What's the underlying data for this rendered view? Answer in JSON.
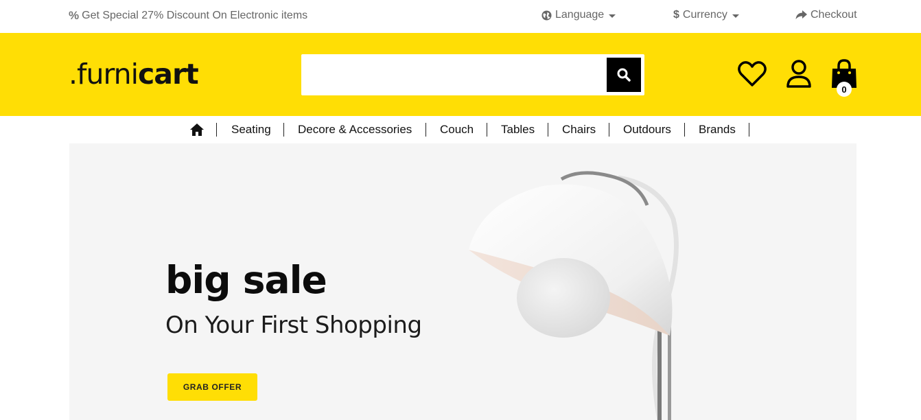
{
  "topbar": {
    "promo_icon": "percent-icon",
    "promo_text": "Get Special 27% Discount On Electronic items",
    "language_label": "Language",
    "currency_label": "Currency",
    "checkout_label": "Checkout"
  },
  "header": {
    "logo_prefix": ".furni",
    "logo_suffix": "cart",
    "search_placeholder": "",
    "cart_count": "0",
    "icons": [
      "heart-icon",
      "user-icon",
      "cart-bag-icon",
      "search-icon"
    ]
  },
  "nav": {
    "home_icon": "home-icon",
    "items": [
      "Seating",
      "Decore & Accessories",
      "Couch",
      "Tables",
      "Chairs",
      "Outdours",
      "Brands"
    ]
  },
  "hero": {
    "title": "big sale",
    "subtitle": "On Your First Shopping",
    "button_label": "GRAB OFFER"
  },
  "colors": {
    "brand_yellow": "#ffde05",
    "hero_bg": "#f5f5f5",
    "text_dark": "#111111",
    "topbar_text": "#666666"
  }
}
